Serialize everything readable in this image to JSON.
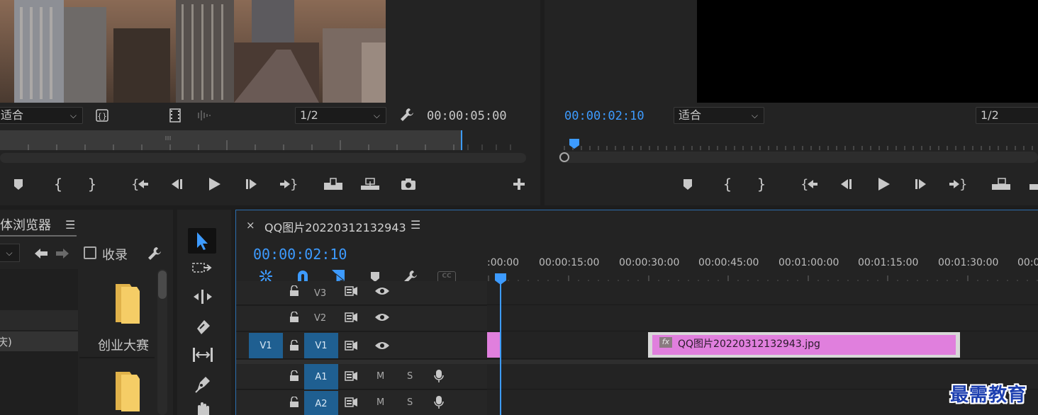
{
  "source_monitor": {
    "fit_label": "适合",
    "resolution": "1/2",
    "timecode": "00:00:05:00"
  },
  "program_monitor": {
    "timecode": "00:00:02:10",
    "fit_label": "适合",
    "resolution": "1/2"
  },
  "project_panel": {
    "title": "体浏览器",
    "favorites_label": "收录",
    "folder1": "创业大赛",
    "row_label": "庆)"
  },
  "timeline": {
    "sequence_name": "QQ图片20220312132943",
    "timecode": "00:00:02:10",
    "ruler_labels": [
      ":00:00",
      "00:00:15:00",
      "00:00:30:00",
      "00:00:45:00",
      "00:01:00:00",
      "00:01:15:00",
      "00:01:30:00",
      "00:0"
    ],
    "clip_name": "QQ图片20220312132943.jpg",
    "fx_label": "fx",
    "cc_label": "CC",
    "tracks": {
      "v3": "V3",
      "v2": "V2",
      "v1_src": "V1",
      "v1": "V1",
      "a1": "A1",
      "a2": "A2",
      "m": "M",
      "s": "S"
    }
  },
  "watermark": "最需教育",
  "colors": {
    "accent_blue": "#3d9bff",
    "track_blue": "#1f5f91",
    "clip_pink": "#e07fdd",
    "work_area_yellow": "#e8e000"
  }
}
